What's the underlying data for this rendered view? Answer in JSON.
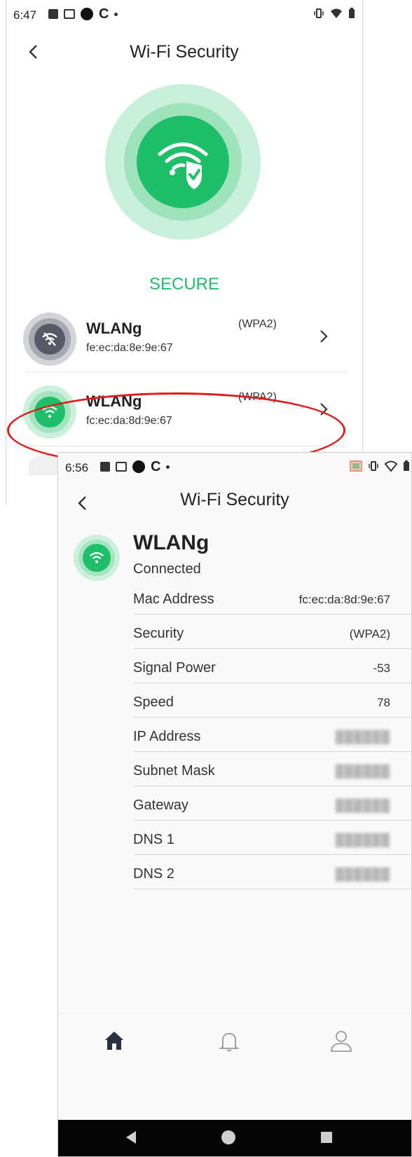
{
  "screen1": {
    "status_bar": {
      "time": "6:47"
    },
    "title": "Wi-Fi Security",
    "status_label": "SECURE",
    "networks": [
      {
        "name": "WLANg",
        "mac": "fe:ec:da:8e:9e:67",
        "security": "(WPA2)",
        "connected": false
      },
      {
        "name": "WLANg",
        "mac": "fc:ec:da:8d:9e:67",
        "security": "(WPA2)",
        "connected": true
      }
    ]
  },
  "screen2": {
    "status_bar": {
      "time": "6:56"
    },
    "title": "Wi-Fi Security",
    "network": {
      "name": "WLANg",
      "status": "Connected"
    },
    "details": [
      {
        "label": "Mac Address",
        "value": "fc:ec:da:8d:9e:67"
      },
      {
        "label": "Security",
        "value": "(WPA2)"
      },
      {
        "label": "Signal Power",
        "value": "-53"
      },
      {
        "label": "Speed",
        "value": "78"
      },
      {
        "label": "IP Address",
        "value": "",
        "redacted": true
      },
      {
        "label": "Subnet Mask",
        "value": "",
        "redacted": true
      },
      {
        "label": "Gateway",
        "value": "",
        "redacted": true
      },
      {
        "label": "DNS 1",
        "value": "",
        "redacted": true
      },
      {
        "label": "DNS 2",
        "value": "",
        "redacted": true
      }
    ],
    "bottom_nav": [
      "home-icon",
      "bell-icon",
      "profile-icon"
    ],
    "system_nav": [
      "back-triangle-icon",
      "home-circle-icon",
      "recents-square-icon"
    ]
  },
  "colors": {
    "accent_green": "#1fbf6a",
    "annotation_red": "#e21b1b",
    "disconnected_gray": "#555a66"
  }
}
